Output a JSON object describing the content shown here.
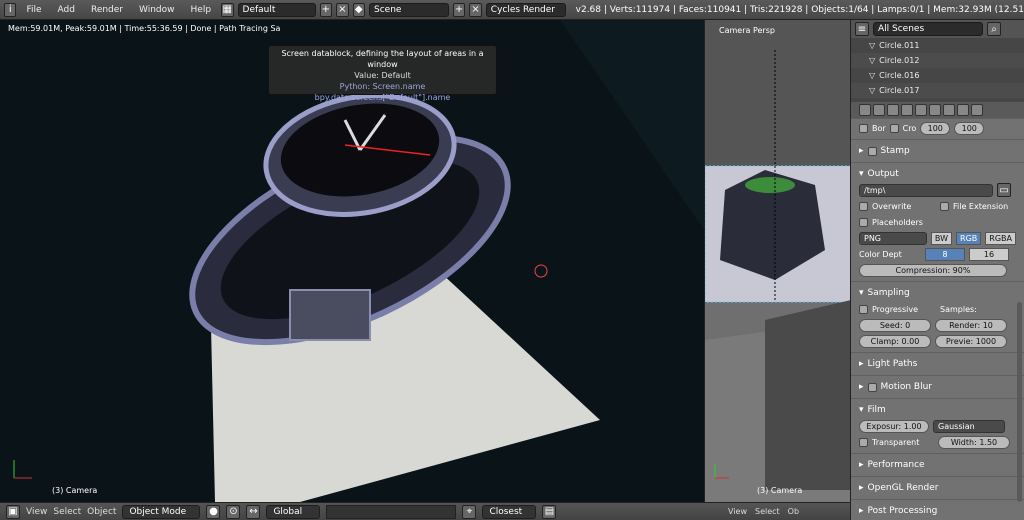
{
  "topbar": {
    "menus": [
      "File",
      "Add",
      "Render",
      "Window",
      "Help"
    ],
    "screen": "Default",
    "scene": "Scene",
    "engine": "Cycles Render",
    "stats": "v2.68 | Verts:111974 | Faces:110941 | Tris:221928 | Objects:1/64 | Lamps:0/1 | Mem:32.93M (12.51"
  },
  "viewport": {
    "info": "Mem:59.01M, Peak:59.01M | Time:55:36.59 | Done | Path Tracing Sa",
    "label": "(3) Camera",
    "tooltip": {
      "title": "Screen datablock, defining the layout of areas in a window",
      "value": "Value: Default",
      "python": "Python: Screen.name",
      "path": "bpy.data.screens[\"Default\"].name"
    }
  },
  "bottombar": {
    "items": [
      "View",
      "Select",
      "Object"
    ],
    "mode": "Object Mode",
    "orientation": "Global",
    "snap": "Closest"
  },
  "camera": {
    "title": "Camera Persp",
    "label": "(3) Camera",
    "bottom": [
      "View",
      "Select",
      "Ob"
    ]
  },
  "outliner": {
    "search": "All Scenes",
    "rows": [
      "Circle.011",
      "Circle.012",
      "Circle.016",
      "Circle.017"
    ]
  },
  "props": {
    "top_values": [
      "Bor",
      "Cro",
      "100",
      "100"
    ],
    "stamp": "Stamp",
    "output": "Output",
    "path": "/tmp\\",
    "overwrite": "Overwrite",
    "file_ext": "File Extension",
    "placeholders": "Placeholders",
    "format": "PNG",
    "bw": "BW",
    "rgb": "RGB",
    "rgba": "RGBA",
    "color_depth": "Color Dept",
    "depth8": "8",
    "depth16": "16",
    "compression": "Compression: 90%",
    "sampling": "Sampling",
    "progressive": "Progressive",
    "samples": "Samples:",
    "seed": "Seed: 0",
    "render": "Render: 10",
    "clamp": "Clamp: 0.00",
    "preview": "Previe: 1000",
    "light_paths": "Light Paths",
    "motion_blur": "Motion Blur",
    "film": "Film",
    "exposure": "Exposur: 1.00",
    "filter": "Gaussian",
    "transparent": "Transparent",
    "width": "Width: 1.50",
    "performance": "Performance",
    "opengl": "OpenGL Render",
    "post": "Post Processing"
  }
}
